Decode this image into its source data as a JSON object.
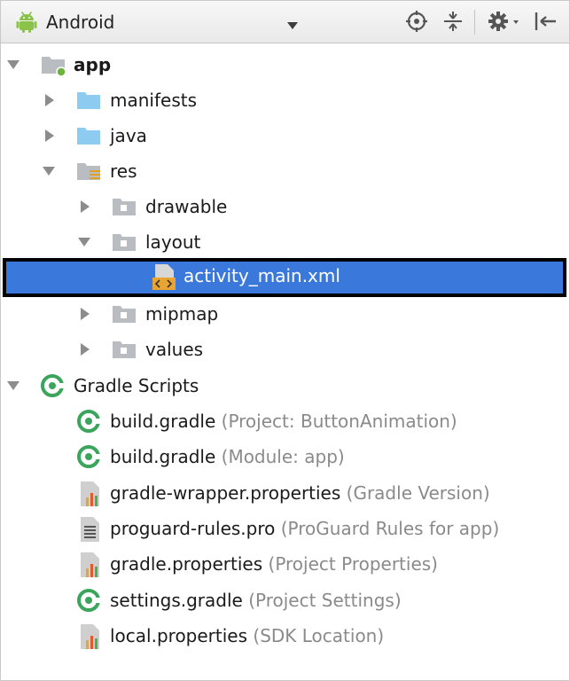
{
  "toolbar": {
    "view_label": "Android",
    "icons": [
      "android-icon",
      "chevron-down-icon",
      "locate-icon",
      "collapse-all-icon",
      "gear-icon",
      "hide-panel-icon"
    ]
  },
  "tree": {
    "app": {
      "label": "app"
    },
    "manifests": {
      "label": "manifests"
    },
    "java": {
      "label": "java"
    },
    "res": {
      "label": "res"
    },
    "drawable": {
      "label": "drawable"
    },
    "layout": {
      "label": "layout"
    },
    "activity_main": {
      "label": "activity_main.xml"
    },
    "mipmap": {
      "label": "mipmap"
    },
    "values": {
      "label": "values"
    },
    "gradle_scripts": {
      "label": "Gradle Scripts"
    },
    "build_gradle_project": {
      "label": "build.gradle",
      "note": "(Project: ButtonAnimation)"
    },
    "build_gradle_module": {
      "label": "build.gradle",
      "note": "(Module: app)"
    },
    "gradle_wrapper": {
      "label": "gradle-wrapper.properties",
      "note": "(Gradle Version)"
    },
    "proguard": {
      "label": "proguard-rules.pro",
      "note": "(ProGuard Rules for app)"
    },
    "gradle_properties": {
      "label": "gradle.properties",
      "note": "(Project Properties)"
    },
    "settings_gradle": {
      "label": "settings.gradle",
      "note": "(Project Settings)"
    },
    "local_properties": {
      "label": "local.properties",
      "note": "(SDK Location)"
    }
  },
  "colors": {
    "selection": "#3b78db",
    "selection_border": "#000000",
    "folder": "#8ecbf0",
    "gradle_green": "#3aa55b",
    "note_gray": "#8a8a8a"
  }
}
